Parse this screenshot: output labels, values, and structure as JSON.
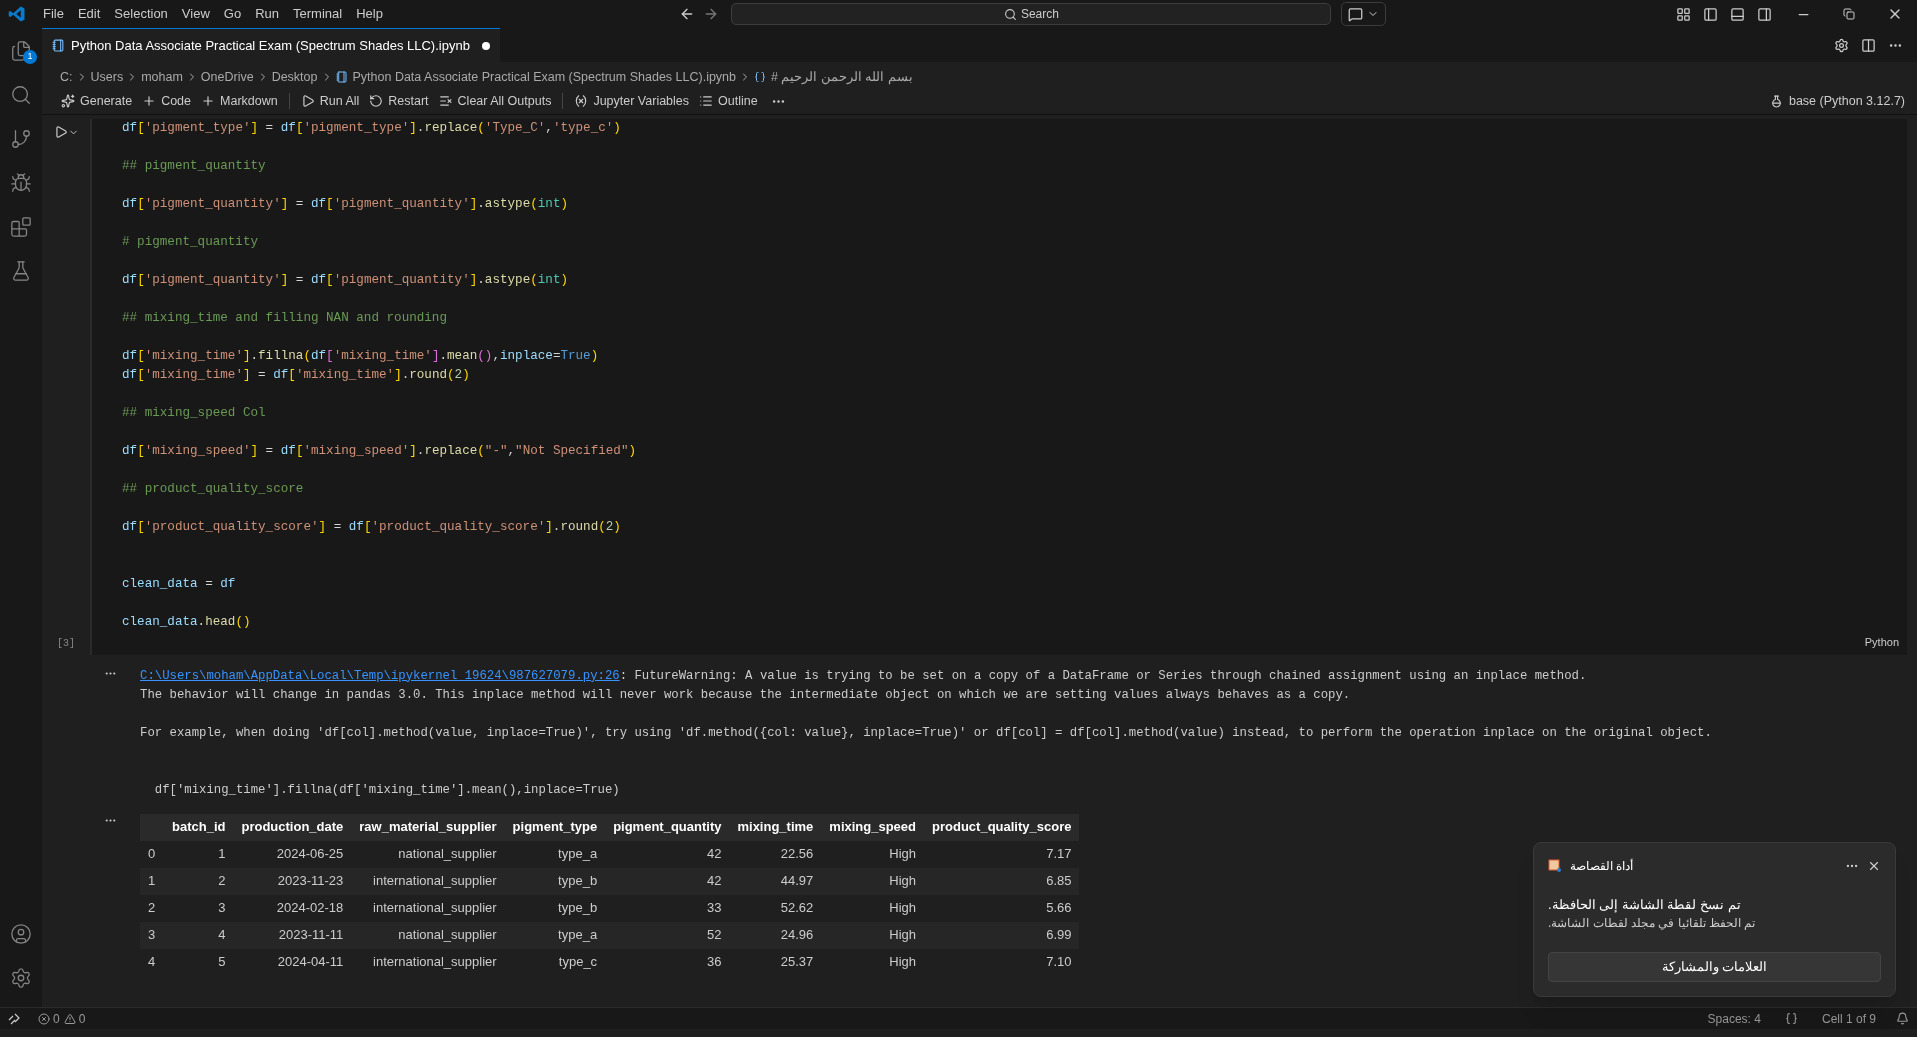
{
  "menu": [
    "File",
    "Edit",
    "Selection",
    "View",
    "Go",
    "Run",
    "Terminal",
    "Help"
  ],
  "search": {
    "placeholder": "Search"
  },
  "activity_badge": "1",
  "tab": {
    "title": "Python Data Associate Practical Exam (Spectrum Shades LLC).ipynb",
    "modified": true
  },
  "breadcrumb": [
    "C:",
    "Users",
    "moham",
    "OneDrive",
    "Desktop",
    "Python Data Associate Practical Exam (Spectrum Shades LLC).ipynb",
    "# بسم الله الرحمن الرحيم"
  ],
  "toolbar": [
    "Generate",
    "Code",
    "Markdown",
    "Run All",
    "Restart",
    "Clear All Outputs",
    "Jupyter Variables",
    "Outline"
  ],
  "kernel": "base (Python 3.12.7)",
  "cell": {
    "execution_count": "[3]",
    "language": "Python",
    "lines": [
      {
        "kind": "code",
        "tokens": [
          {
            "text": "df",
            "kind": "v"
          },
          {
            "text": "[",
            "kind": "b1"
          },
          {
            "text": "'pigment_type'",
            "kind": "s"
          },
          {
            "text": "]",
            "kind": "b1"
          },
          {
            "text": " = ",
            "kind": "o"
          },
          {
            "text": "df",
            "kind": "v"
          },
          {
            "text": "[",
            "kind": "b1"
          },
          {
            "text": "'pigment_type'",
            "kind": "s"
          },
          {
            "text": "]",
            "kind": "b1"
          },
          {
            "text": ".",
            "kind": "o"
          },
          {
            "text": "replace",
            "kind": "f"
          },
          {
            "text": "(",
            "kind": "b1"
          },
          {
            "text": "'Type_C'",
            "kind": "s"
          },
          {
            "text": ",",
            "kind": "o"
          },
          {
            "text": "'type_c'",
            "kind": "s"
          },
          {
            "text": ")",
            "kind": "b1"
          }
        ]
      },
      {
        "kind": "blank"
      },
      {
        "kind": "comment",
        "tokens": [
          {
            "text": "## pigment_quantity",
            "kind": "c"
          }
        ]
      },
      {
        "kind": "blank"
      },
      {
        "kind": "code",
        "tokens": [
          {
            "text": "df",
            "kind": "v"
          },
          {
            "text": "[",
            "kind": "b1"
          },
          {
            "text": "'pigment_quantity'",
            "kind": "s"
          },
          {
            "text": "]",
            "kind": "b1"
          },
          {
            "text": " = ",
            "kind": "o"
          },
          {
            "text": "df",
            "kind": "v"
          },
          {
            "text": "[",
            "kind": "b1"
          },
          {
            "text": "'pigment_quantity'",
            "kind": "s"
          },
          {
            "text": "]",
            "kind": "b1"
          },
          {
            "text": ".",
            "kind": "o"
          },
          {
            "text": "astype",
            "kind": "f"
          },
          {
            "text": "(",
            "kind": "b1"
          },
          {
            "text": "int",
            "kind": "t"
          },
          {
            "text": ")",
            "kind": "b1"
          }
        ]
      },
      {
        "kind": "blank"
      },
      {
        "kind": "comment",
        "tokens": [
          {
            "text": "# pigment_quantity",
            "kind": "c"
          }
        ]
      },
      {
        "kind": "blank"
      },
      {
        "kind": "code",
        "tokens": [
          {
            "text": "df",
            "kind": "v"
          },
          {
            "text": "[",
            "kind": "b1"
          },
          {
            "text": "'pigment_quantity'",
            "kind": "s"
          },
          {
            "text": "]",
            "kind": "b1"
          },
          {
            "text": " = ",
            "kind": "o"
          },
          {
            "text": "df",
            "kind": "v"
          },
          {
            "text": "[",
            "kind": "b1"
          },
          {
            "text": "'pigment_quantity'",
            "kind": "s"
          },
          {
            "text": "]",
            "kind": "b1"
          },
          {
            "text": ".",
            "kind": "o"
          },
          {
            "text": "astype",
            "kind": "f"
          },
          {
            "text": "(",
            "kind": "b1"
          },
          {
            "text": "int",
            "kind": "t"
          },
          {
            "text": ")",
            "kind": "b1"
          }
        ]
      },
      {
        "kind": "blank"
      },
      {
        "kind": "comment",
        "tokens": [
          {
            "text": "## mixing_time and filling NAN and rounding",
            "kind": "c"
          }
        ]
      },
      {
        "kind": "blank"
      },
      {
        "kind": "code",
        "tokens": [
          {
            "text": "df",
            "kind": "v"
          },
          {
            "text": "[",
            "kind": "b1"
          },
          {
            "text": "'mixing_time'",
            "kind": "s"
          },
          {
            "text": "]",
            "kind": "b1"
          },
          {
            "text": ".",
            "kind": "o"
          },
          {
            "text": "fillna",
            "kind": "f"
          },
          {
            "text": "(",
            "kind": "b1"
          },
          {
            "text": "df",
            "kind": "v"
          },
          {
            "text": "[",
            "kind": "b2"
          },
          {
            "text": "'mixing_time'",
            "kind": "s"
          },
          {
            "text": "]",
            "kind": "b2"
          },
          {
            "text": ".",
            "kind": "o"
          },
          {
            "text": "mean",
            "kind": "f"
          },
          {
            "text": "()",
            "kind": "b2"
          },
          {
            "text": ",",
            "kind": "o"
          },
          {
            "text": "inplace",
            "kind": "v"
          },
          {
            "text": "=",
            "kind": "o"
          },
          {
            "text": "True",
            "kind": "k"
          },
          {
            "text": ")",
            "kind": "b1"
          }
        ]
      },
      {
        "kind": "code",
        "tokens": [
          {
            "text": "df",
            "kind": "v"
          },
          {
            "text": "[",
            "kind": "b1"
          },
          {
            "text": "'mixing_time'",
            "kind": "s"
          },
          {
            "text": "]",
            "kind": "b1"
          },
          {
            "text": " = ",
            "kind": "o"
          },
          {
            "text": "df",
            "kind": "v"
          },
          {
            "text": "[",
            "kind": "b1"
          },
          {
            "text": "'mixing_time'",
            "kind": "s"
          },
          {
            "text": "]",
            "kind": "b1"
          },
          {
            "text": ".",
            "kind": "o"
          },
          {
            "text": "round",
            "kind": "f"
          },
          {
            "text": "(",
            "kind": "b1"
          },
          {
            "text": "2",
            "kind": "n"
          },
          {
            "text": ")",
            "kind": "b1"
          }
        ]
      },
      {
        "kind": "blank"
      },
      {
        "kind": "comment",
        "tokens": [
          {
            "text": "## mixing_speed Col",
            "kind": "c"
          }
        ]
      },
      {
        "kind": "blank"
      },
      {
        "kind": "code",
        "tokens": [
          {
            "text": "df",
            "kind": "v"
          },
          {
            "text": "[",
            "kind": "b1"
          },
          {
            "text": "'mixing_speed'",
            "kind": "s"
          },
          {
            "text": "]",
            "kind": "b1"
          },
          {
            "text": " = ",
            "kind": "o"
          },
          {
            "text": "df",
            "kind": "v"
          },
          {
            "text": "[",
            "kind": "b1"
          },
          {
            "text": "'mixing_speed'",
            "kind": "s"
          },
          {
            "text": "]",
            "kind": "b1"
          },
          {
            "text": ".",
            "kind": "o"
          },
          {
            "text": "replace",
            "kind": "f"
          },
          {
            "text": "(",
            "kind": "b1"
          },
          {
            "text": "\"-\"",
            "kind": "s"
          },
          {
            "text": ",",
            "kind": "o"
          },
          {
            "text": "\"Not Specified\"",
            "kind": "s"
          },
          {
            "text": ")",
            "kind": "b1"
          }
        ]
      },
      {
        "kind": "blank"
      },
      {
        "kind": "comment",
        "tokens": [
          {
            "text": "## product_quality_score",
            "kind": "c"
          }
        ]
      },
      {
        "kind": "blank"
      },
      {
        "kind": "code",
        "tokens": [
          {
            "text": "df",
            "kind": "v"
          },
          {
            "text": "[",
            "kind": "b1"
          },
          {
            "text": "'product_quality_score'",
            "kind": "s"
          },
          {
            "text": "]",
            "kind": "b1"
          },
          {
            "text": " = ",
            "kind": "o"
          },
          {
            "text": "df",
            "kind": "v"
          },
          {
            "text": "[",
            "kind": "b1"
          },
          {
            "text": "'product_quality_score'",
            "kind": "s"
          },
          {
            "text": "]",
            "kind": "b1"
          },
          {
            "text": ".",
            "kind": "o"
          },
          {
            "text": "round",
            "kind": "f"
          },
          {
            "text": "(",
            "kind": "b1"
          },
          {
            "text": "2",
            "kind": "n"
          },
          {
            "text": ")",
            "kind": "b1"
          }
        ]
      },
      {
        "kind": "blank"
      },
      {
        "kind": "blank"
      },
      {
        "kind": "code",
        "tokens": [
          {
            "text": "clean_data",
            "kind": "v"
          },
          {
            "text": " = ",
            "kind": "o"
          },
          {
            "text": "df",
            "kind": "v"
          }
        ]
      },
      {
        "kind": "blank"
      },
      {
        "kind": "code",
        "tokens": [
          {
            "text": "clean_data",
            "kind": "v"
          },
          {
            "text": ".",
            "kind": "o"
          },
          {
            "text": "head",
            "kind": "f"
          },
          {
            "text": "()",
            "kind": "b1"
          }
        ]
      }
    ]
  },
  "output": {
    "link": "C:\\Users\\moham\\AppData\\Local\\Temp\\ipykernel_19624\\987627079.py:26",
    "warning": ": FutureWarning: A value is trying to be set on a copy of a DataFrame or Series through chained assignment using an inplace method.",
    "lines": [
      "The behavior will change in pandas 3.0. This inplace method will never work because the intermediate object on which we are setting values always behaves as a copy.",
      "For example, when doing 'df[col].method(value, inplace=True)', try using 'df.method({col: value}, inplace=True)' or df[col] = df[col].method(value) instead, to perform the operation inplace on the original object."
    ],
    "source_line": "  df['mixing_time'].fillna(df['mixing_time'].mean(),inplace=True)"
  },
  "table": {
    "columns": [
      "",
      "batch_id",
      "production_date",
      "raw_material_supplier",
      "pigment_type",
      "pigment_quantity",
      "mixing_time",
      "mixing_speed",
      "product_quality_score"
    ],
    "rows": [
      [
        "0",
        "1",
        "2024-06-25",
        "national_supplier",
        "type_a",
        "42",
        "22.56",
        "High",
        "7.17"
      ],
      [
        "1",
        "2",
        "2023-11-23",
        "international_supplier",
        "type_b",
        "42",
        "44.97",
        "High",
        "6.85"
      ],
      [
        "2",
        "3",
        "2024-02-18",
        "international_supplier",
        "type_b",
        "33",
        "52.62",
        "High",
        "5.66"
      ],
      [
        "3",
        "4",
        "2023-11-11",
        "national_supplier",
        "type_a",
        "52",
        "24.96",
        "High",
        "6.99"
      ],
      [
        "4",
        "5",
        "2024-04-11",
        "international_supplier",
        "type_c",
        "36",
        "25.37",
        "High",
        "7.10"
      ]
    ]
  },
  "toast": {
    "app": "أداة القصاصة",
    "message": "تم نسخ لقطة الشاشة إلى الحافظة.",
    "detail": "تم الحفظ تلقائيا في مجلد لقطات الشاشة.",
    "button": "العلامات والمشاركة"
  },
  "status": {
    "errors": "0",
    "warnings": "0",
    "spaces": "Spaces: 4",
    "cell": "Cell 1 of 9"
  }
}
